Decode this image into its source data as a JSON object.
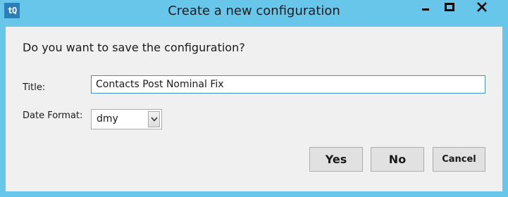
{
  "window": {
    "title": "Create a new configuration",
    "app_icon_text": "tQ",
    "accent_color": "#67c6ea",
    "controls": {
      "minimize_icon": "minimize-icon",
      "maximize_icon": "maximize-icon",
      "close_icon": "close-icon"
    }
  },
  "dialog": {
    "question": "Do you want to save the configuration?",
    "title_label": "Title:",
    "title_value": "Contacts Post Nominal Fix",
    "date_format_label": "Date Format:",
    "date_format_value": "dmy",
    "yes_label": "Yes",
    "no_label": "No",
    "cancel_label": "Cancel"
  }
}
